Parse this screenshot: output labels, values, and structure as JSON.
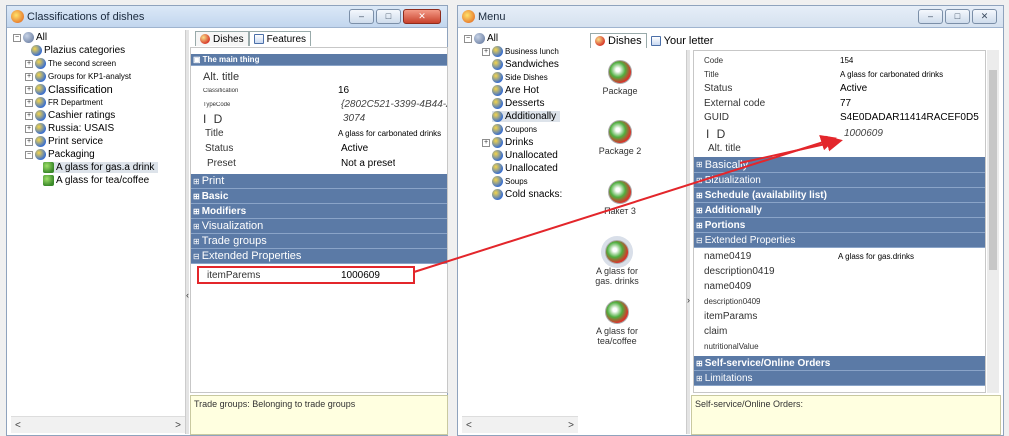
{
  "left_window": {
    "title": "Classifications of dishes",
    "controls": [
      "–",
      "□",
      "✕"
    ],
    "tree": {
      "root": "All",
      "items": [
        "Plazius categories",
        "The second screen",
        "Groups for KP1-analyst",
        "Classification",
        "FR Department",
        "Cashier ratings",
        "Russia: USAIS",
        "Print service",
        "Packaging"
      ],
      "children": [
        "A glass for gas.a drink",
        "A glass for tea/coffee"
      ]
    },
    "tabs": [
      "Dishes",
      "Features"
    ],
    "props": {
      "header": "The main thing",
      "alt_title": "Alt. title",
      "classification_label": "Classification",
      "classification_value": "16",
      "guid_label": "TypeCode",
      "guid_value": "{2802C521-3399-4B44-AA5",
      "code_label": "I D",
      "code_value": "3074",
      "title_label": "Title",
      "title_value": "A glass for carbonated drinks",
      "status_label": "Status",
      "status_value": "Active",
      "preset_label": "Preset",
      "preset_value": "Not a preset",
      "bands": [
        "Print",
        "Basic",
        "Modifiers",
        "Visualization",
        "Trade groups",
        "Extended Properties"
      ],
      "item_params_label": "itemParems",
      "item_params_value": "1000609"
    },
    "description": "Trade groups: Belonging to trade groups"
  },
  "right_window": {
    "title": "Menu",
    "controls": [
      "–",
      "□",
      "✕"
    ],
    "tree": {
      "root": "All",
      "items": [
        "Business lunch",
        "Sandwiches",
        "Side Dishes",
        "Are Hot",
        "Desserts",
        "Additionally",
        "Coupons",
        "Drinks",
        "Unallocated",
        "Unallocated",
        "Soups",
        "Cold snacks:"
      ]
    },
    "tabs": [
      "Dishes",
      "Your letter"
    ],
    "cards": [
      "Package",
      "Package 2",
      "Пакет 3",
      "A glass for gas. drinks",
      "A glass for tea/coffee"
    ],
    "props": {
      "code_label": "Code",
      "code_value": "154",
      "title_label": "Title",
      "title_value": "A glass for carbonated drinks",
      "status_label": "Status",
      "status_value": "Active",
      "ext_code_label": "External code",
      "ext_code_value": "77",
      "guid_label": "GUID",
      "guid_value": "S4E0DADAR11414RACEF0D5",
      "id_label": "I D",
      "id_value": "1000609",
      "alt_title": "Alt. title",
      "bands": [
        "Basically",
        "Bizualization",
        "Schedule (availability list)",
        "Additionally",
        "Portions",
        "Extended Properties"
      ],
      "ext_props": [
        {
          "k": "name0419",
          "v": "A glass for gas.drinks"
        },
        {
          "k": "description0419",
          "v": ""
        },
        {
          "k": "name0409",
          "v": ""
        },
        {
          "k": "description0409",
          "v": ""
        },
        {
          "k": "itemParams",
          "v": ""
        },
        {
          "k": "claim",
          "v": ""
        },
        {
          "k": "nutritionalValue",
          "v": ""
        }
      ],
      "bands_after": [
        "Self-service/Online Orders",
        "Limitations"
      ]
    },
    "description": "Self-service/Online Orders:"
  },
  "colors": {
    "band": "#5b7aa6",
    "annotation": "#e3262b"
  }
}
